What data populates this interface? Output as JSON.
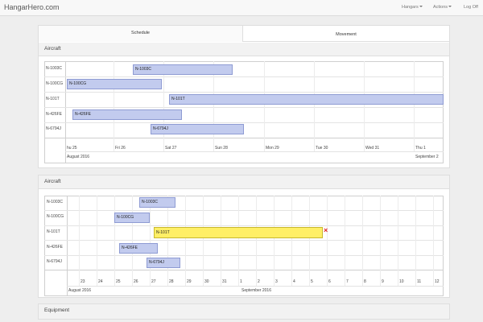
{
  "app": {
    "brand": "HangarHero.com",
    "nav": {
      "hangars": "Hangars",
      "actions": "Actions",
      "logoff": "Log Off"
    }
  },
  "tabs": {
    "schedule": "Schedule",
    "movement": "Movement"
  },
  "schedule": {
    "title": "Aircraft",
    "rows": [
      "N-1003C",
      "N-100CG",
      "N-101T",
      "N-426FE",
      "N-6794J"
    ],
    "bars": [
      "N-1003C",
      "N-100CG",
      "N-101T",
      "N-426FE",
      "N-6794J"
    ],
    "days": [
      "hu 25",
      "Fri 26",
      "Sat 27",
      "Sun 28",
      "Mon 29",
      "Tue 30",
      "Wed 31",
      "Thu 1"
    ],
    "month_left": "August 2016",
    "month_right": "September 2"
  },
  "movement": {
    "title": "Aircraft",
    "rows": [
      "N-1003C",
      "N-100CG",
      "N-101T",
      "N-426FE",
      "N-6794J"
    ],
    "bars": [
      "N-1003C",
      "N-100CG",
      "N-101T",
      "N-426FE",
      "N-6794J"
    ],
    "days": [
      "23",
      "24",
      "25",
      "26",
      "27",
      "28",
      "29",
      "30",
      "31",
      "1",
      "2",
      "3",
      "4",
      "5",
      "6",
      "7",
      "8",
      "9",
      "10",
      "11",
      "12"
    ],
    "month_left": "August 2016",
    "month_right": "September 2016",
    "delete_icon": "×"
  },
  "equipment": {
    "title": "Equipment"
  },
  "colors": {
    "bar": "#c2cbee",
    "bar_border": "#8e9bd3",
    "highlight": "#ffef66",
    "delete": "#dd2222"
  },
  "icons": {
    "nav_caret": "caret-down-icon",
    "delete": "close-icon"
  }
}
